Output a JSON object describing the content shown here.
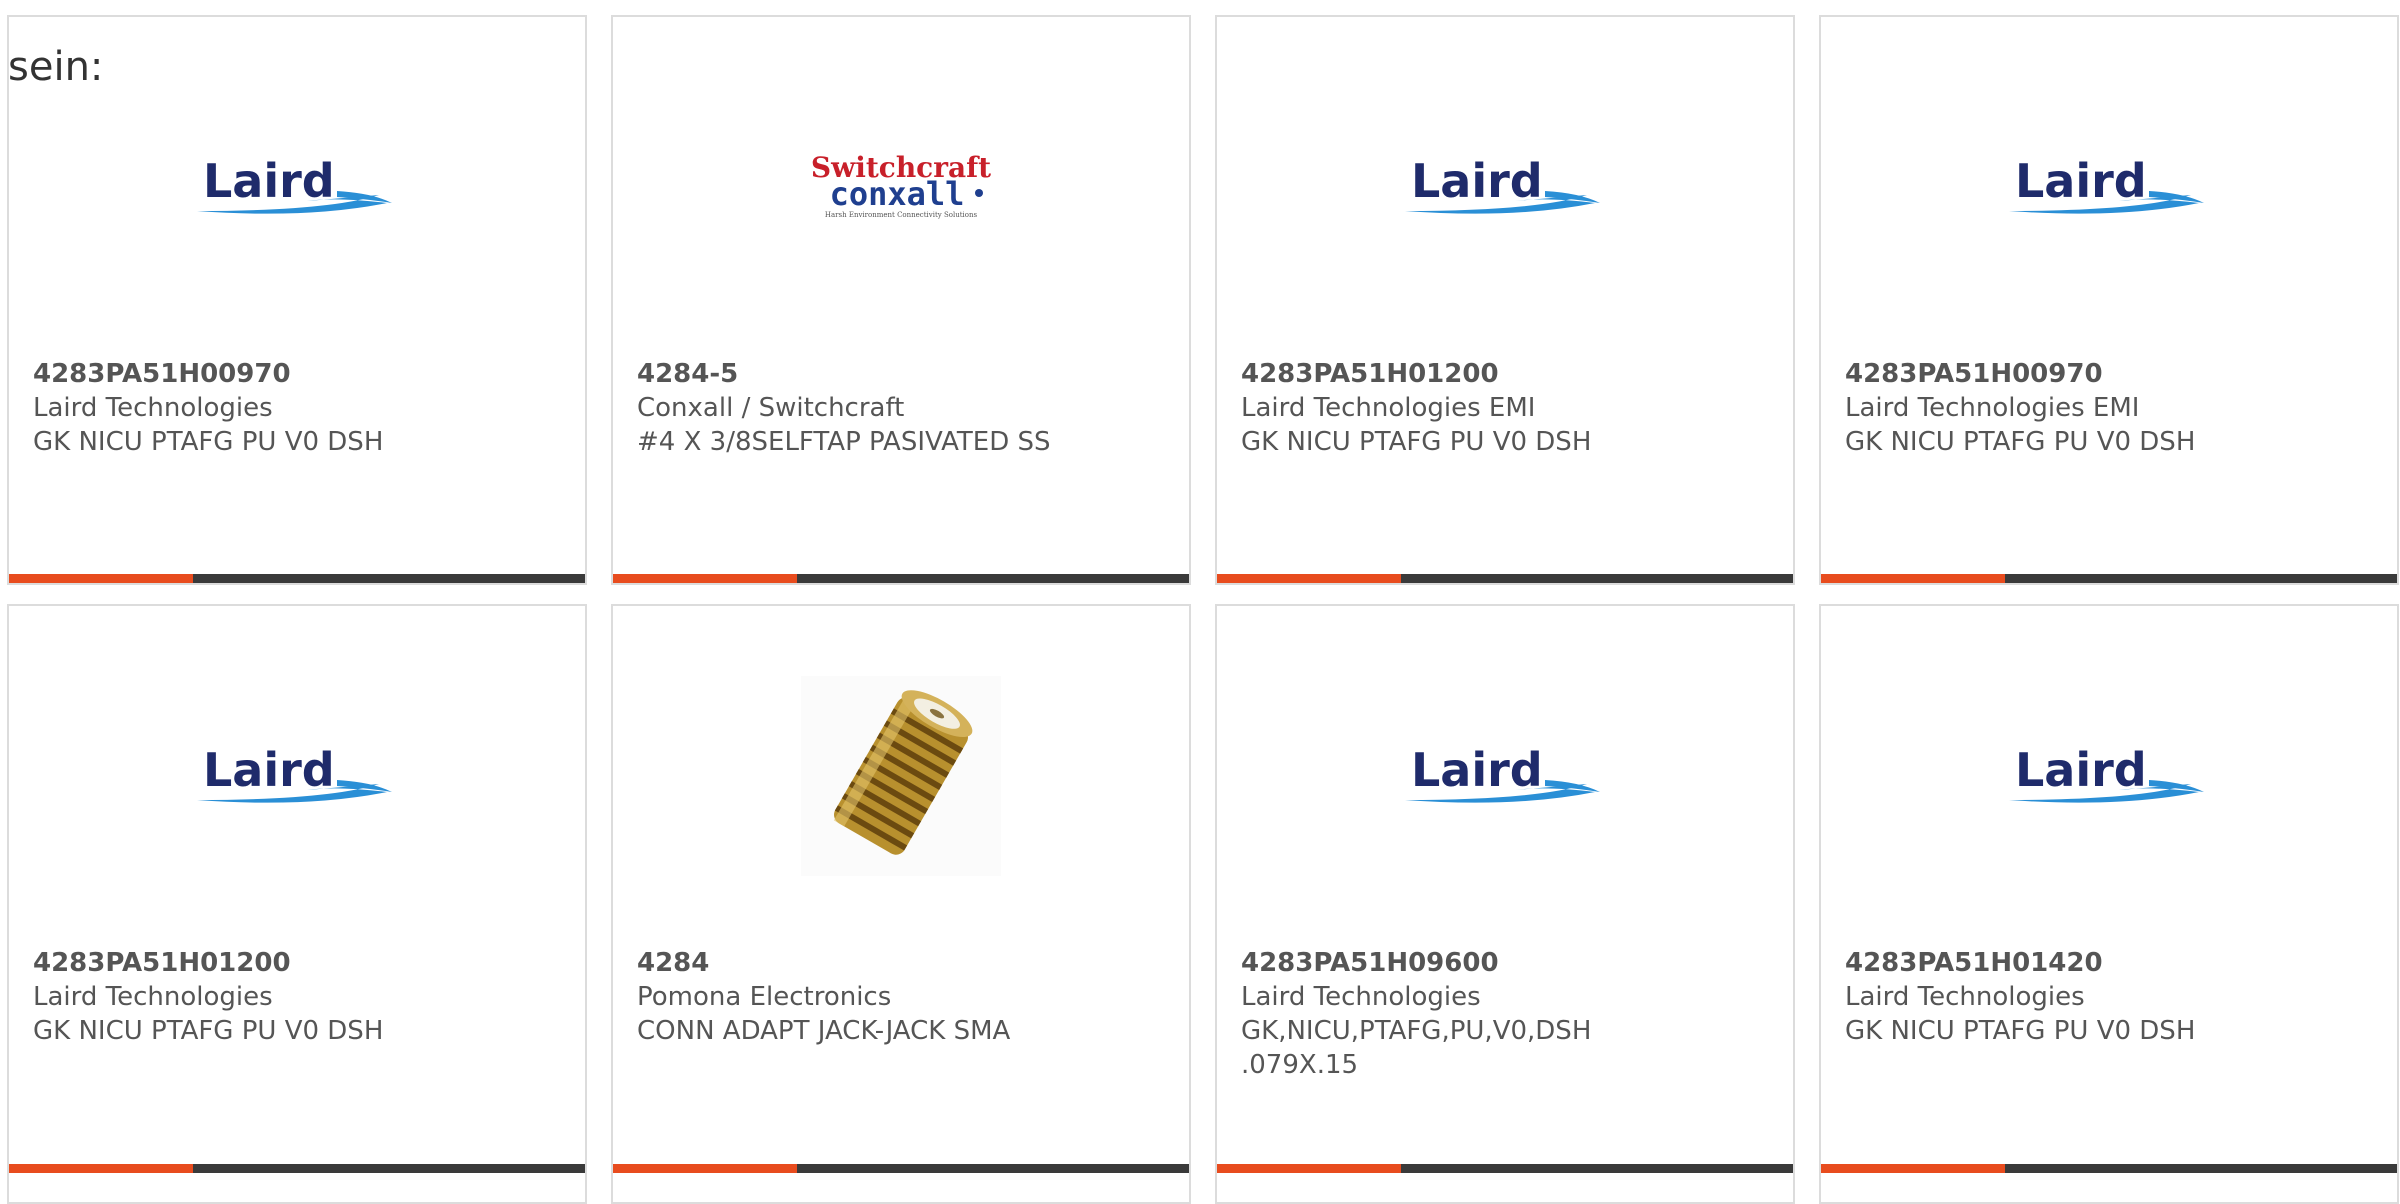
{
  "intro_text": "sein:",
  "colors": {
    "accent": "#e84c1e",
    "bar_dark": "#3a3a3a",
    "card_border": "#dcdcdc",
    "laird_blue": "#1f2b6b",
    "swoosh_blue": "#2a8fd6",
    "switchcraft_red": "#c8202a",
    "conxall_blue": "#1f3f8f"
  },
  "products": [
    {
      "part_number": "4283PA51H00970",
      "manufacturer": "Laird Technologies",
      "description": "GK NICU PTAFG PU V0 DSH",
      "logo": "laird-logo",
      "logo_text": "Laird"
    },
    {
      "part_number": "4284-5",
      "manufacturer": "Conxall / Switchcraft",
      "description": "#4 X 3/8SELFTAP PASIVATED SS",
      "logo": "switchcraft-conxall-logo",
      "logo_text": "Switchcraft",
      "logo_text_2": "conxall",
      "logo_tagline": "Harsh Environment Connectivity Solutions"
    },
    {
      "part_number": "4283PA51H01200",
      "manufacturer": "Laird Technologies EMI",
      "description": "GK NICU PTAFG PU V0 DSH",
      "logo": "laird-logo",
      "logo_text": "Laird"
    },
    {
      "part_number": "4283PA51H00970",
      "manufacturer": "Laird Technologies EMI",
      "description": "GK NICU PTAFG PU V0 DSH",
      "logo": "laird-logo",
      "logo_text": "Laird"
    },
    {
      "part_number": "4283PA51H01200",
      "manufacturer": "Laird Technologies",
      "description": "GK NICU PTAFG PU V0 DSH",
      "logo": "laird-logo",
      "logo_text": "Laird"
    },
    {
      "part_number": "4284",
      "manufacturer": "Pomona Electronics",
      "description": "CONN ADAPT JACK-JACK SMA",
      "logo": "sma-adapter-photo"
    },
    {
      "part_number": "4283PA51H09600",
      "manufacturer": "Laird Technologies",
      "description": "GK,NICU,PTAFG,PU,V0,DSH .079X.15",
      "logo": "laird-logo",
      "logo_text": "Laird"
    },
    {
      "part_number": "4283PA51H01420",
      "manufacturer": "Laird Technologies",
      "description": "GK NICU PTAFG PU V0 DSH",
      "logo": "laird-logo",
      "logo_text": "Laird"
    }
  ]
}
